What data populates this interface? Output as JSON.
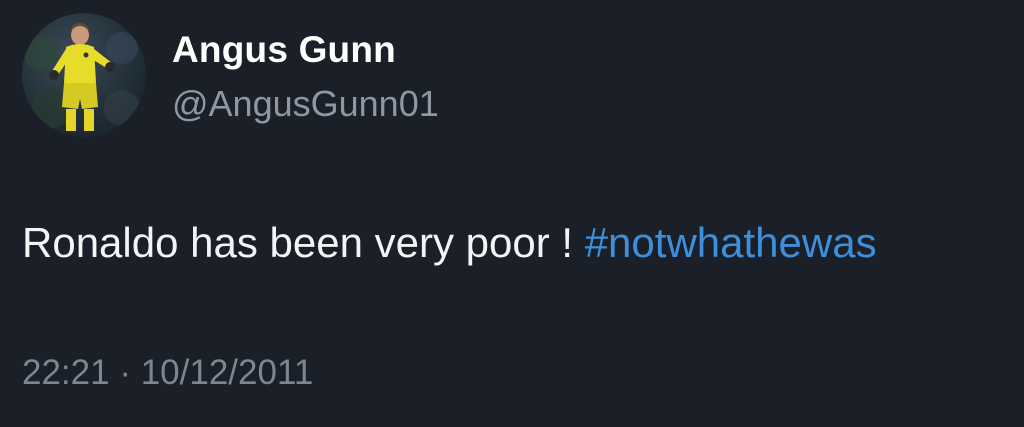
{
  "author": {
    "display_name": "Angus Gunn",
    "handle": "@AngusGunn01",
    "avatar_icon": "goalkeeper-profile-photo"
  },
  "tweet": {
    "text": "Ronaldo has been very poor ! ",
    "hashtag": "#notwhathewas"
  },
  "meta": {
    "time": "22:21",
    "separator": "·",
    "date": "10/12/2011"
  },
  "colors": {
    "background": "#1b1f27",
    "name": "#ffffff",
    "handle": "#8e97a2",
    "text": "#f2f4f6",
    "hashtag": "#3d8fdc",
    "timestamp": "#7c8590",
    "kit": "#e8dc2a"
  }
}
